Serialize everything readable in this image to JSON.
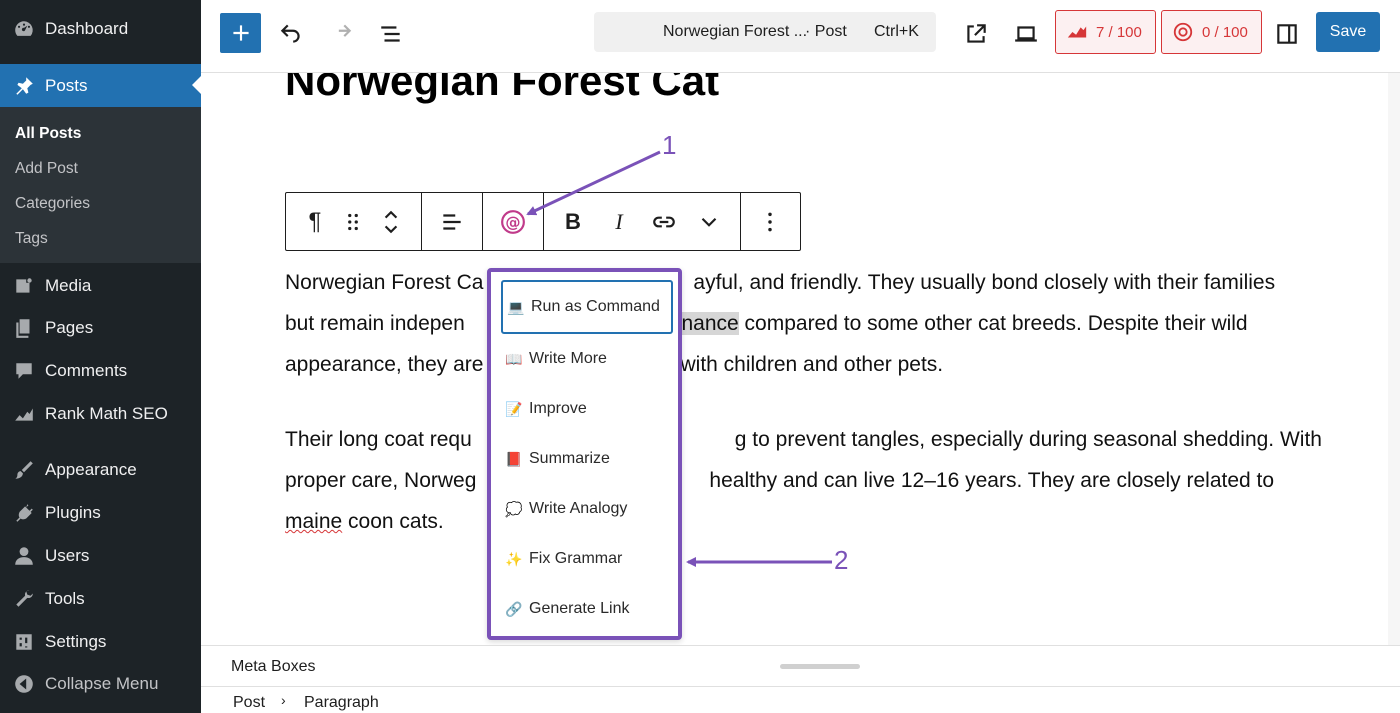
{
  "sidebar": {
    "items": [
      {
        "label": "Dashboard",
        "icon": "dashboard-icon"
      },
      {
        "label": "Posts",
        "icon": "pin-icon"
      },
      {
        "label": "Media",
        "icon": "media-icon"
      },
      {
        "label": "Pages",
        "icon": "pages-icon"
      },
      {
        "label": "Comments",
        "icon": "comment-icon"
      },
      {
        "label": "Rank Math SEO",
        "icon": "rank-math-icon"
      },
      {
        "label": "Appearance",
        "icon": "brush-icon"
      },
      {
        "label": "Plugins",
        "icon": "plug-icon"
      },
      {
        "label": "Users",
        "icon": "user-icon"
      },
      {
        "label": "Tools",
        "icon": "wrench-icon"
      },
      {
        "label": "Settings",
        "icon": "settings-icon"
      }
    ],
    "submenu": [
      "All Posts",
      "Add Post",
      "Categories",
      "Tags"
    ],
    "collapse_label": "Collapse Menu"
  },
  "topbar": {
    "doc_title": "Norwegian Forest ...",
    "doc_type": "· Post",
    "shortcut": "Ctrl+K",
    "seo_score": "7 / 100",
    "content_ai_score": "0 / 100",
    "save_label": "Save"
  },
  "post": {
    "title": "Norwegian Forest Cat",
    "para1": {
      "line1": "Norwegian Forest Ca",
      "line1_end": "ayful, and friendly. They usually bond closely with their families",
      "line2": "but remain indepen",
      "line2_hl": "enance",
      "line2_end": " compared to some other cat breeds. Despite their wild",
      "line3": "appearance, they are",
      "line3_end": "with children and other pets."
    },
    "para2": {
      "line1": "Their long coat requ",
      "line1_end": "g to prevent tangles, especially during seasonal shedding. With",
      "line2": "proper care, Norweg",
      "line2_end": "healthy and can live 12–16 years. They are closely related to",
      "line3_squig": "maine",
      "line3_end": " coon cats."
    }
  },
  "ai_menu": {
    "items": [
      {
        "label": "Run as Command",
        "emoji": "💻"
      },
      {
        "label": "Write More",
        "emoji": "📖"
      },
      {
        "label": "Improve",
        "emoji": "📝"
      },
      {
        "label": "Summarize",
        "emoji": "📕"
      },
      {
        "label": "Write Analogy",
        "emoji": "💭"
      },
      {
        "label": "Fix Grammar",
        "emoji": "✨"
      },
      {
        "label": "Generate Link",
        "emoji": "🔗"
      }
    ]
  },
  "annotations": {
    "one": "1",
    "two": "2"
  },
  "bottom": {
    "meta_boxes": "Meta Boxes",
    "breadcrumb_post": "Post",
    "breadcrumb_para": "Paragraph"
  },
  "colors": {
    "sidebar_bg": "#1d2327",
    "accent": "#2271b1",
    "annotation": "#7a52b8",
    "score_red": "#d63638"
  }
}
